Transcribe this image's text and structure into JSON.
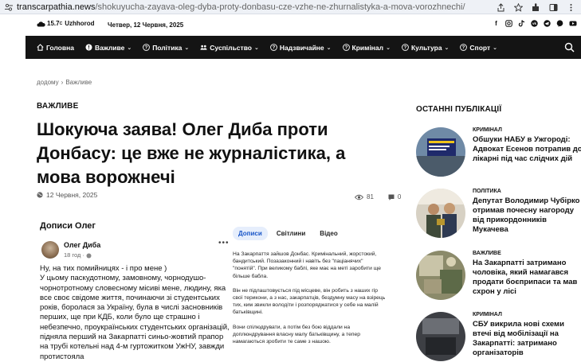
{
  "browser": {
    "url_host": "transcarpathia.news",
    "url_path": "/shokuyucha-zayava-oleg-dyba-proty-donbasu-cze-vzhe-ne-zhurnalistyka-a-mova-vorozhnechi/"
  },
  "topbar": {
    "temperature": "15.7",
    "degree": "C",
    "city": "Uzhhorod",
    "date": "Четвер, 12 Червня, 2025",
    "socials": [
      "facebook-icon",
      "instagram-icon",
      "tiktok-icon",
      "vk-icon",
      "telegram-icon",
      "viber-icon",
      "youtube-icon"
    ]
  },
  "nav": {
    "items": [
      {
        "label": "Головна",
        "icon": "home-icon",
        "dropdown": false
      },
      {
        "label": "Важливе",
        "icon": "alert-icon",
        "dropdown": true
      },
      {
        "label": "Політика",
        "icon": "question-icon",
        "dropdown": true
      },
      {
        "label": "Суспільство",
        "icon": "people-icon",
        "dropdown": true
      },
      {
        "label": "Надзвичайне",
        "icon": "question-icon",
        "dropdown": true
      },
      {
        "label": "Кримінал",
        "icon": "question-icon",
        "dropdown": true
      },
      {
        "label": "Культура",
        "icon": "question-icon",
        "dropdown": true
      },
      {
        "label": "Спорт",
        "icon": "question-icon",
        "dropdown": true
      }
    ]
  },
  "breadcrumb": {
    "home": "додому",
    "separator": "›",
    "current": "Важливе"
  },
  "article": {
    "category": "ВАЖЛИВЕ",
    "title": "Шокуюча заява! Олег Диба проти Донбасу: це вже не журналістика, а мова ворожнечі",
    "date": "12 Червня, 2025",
    "views": "81",
    "comments": "0"
  },
  "screenshot1": {
    "header": "Дописи Олег",
    "author": "Олег Диба",
    "ago": "18 год ·",
    "text": "Ну, на тих помийницях - і про мене )\nУ цьому паскудотному, замовному, чорнодушо-чорнотротному словесному місиві мене, людину, яка все своє свідоме життя, починаючи зі студентських років, боролася за Україну, була в числі засновників перших, ще при КДБ, коли було ще страшно і небезпечно, проукраїнських студентських організацій, підняла перший на Закарпатті синьо-жовтий прапор на трубі котельні над 4-м гуртожитком УжНУ, завжди протистояла"
  },
  "screenshot2": {
    "tabs": [
      "Дописи",
      "Світлини",
      "Відео"
    ],
    "paragraphs": [
      "На Закарпаття зайшов Донбас. Кримінальний, жорстокий, бандитський. Позазаконний і навіть без \"паціанячих\" \"понятій\". При великому баблі, яке має на меті заробити ще більше бабла.",
      "Він не підлаштовується під місцеве, він робить з наших гір свої терикони, а з нас, закарпатців, бездумну масу на взірець тих, ким звикли володіти і розпоряджатися у себе на малій батьківщині.",
      "Вони спілюдрувати, а потім без бою віддали на доплюндрування власну малу батьківщину, а тепер намагаються зробити те саме з нашою."
    ]
  },
  "sidebar": {
    "title": "ОСТАННІ ПУБЛІКАЦІЇ",
    "posts": [
      {
        "category": "КРИМІНАЛ",
        "title": "Обшуки НАБУ в Ужгороді: Адвокат Есенов потрапив до лікарні під час слідчих дій"
      },
      {
        "category": "ПОЛІТИКА",
        "title": "Депутат Володимир Чубірко отримав почесну нагороду від прикордонників Мукачева"
      },
      {
        "category": "ВАЖЛИВЕ",
        "title": "На Закарпатті затримано чоловіка, який намагався продати боєприпаси та мав схрон у лісі"
      },
      {
        "category": "КРИМІНАЛ",
        "title": "СБУ викрила нові схеми втечі від мобілізації на Закарпатті: затримано організаторів"
      }
    ]
  },
  "colors": {
    "nav_bg": "#141414",
    "tab_active_bg": "#e6eefc",
    "tab_active_text": "#1a56c8"
  }
}
